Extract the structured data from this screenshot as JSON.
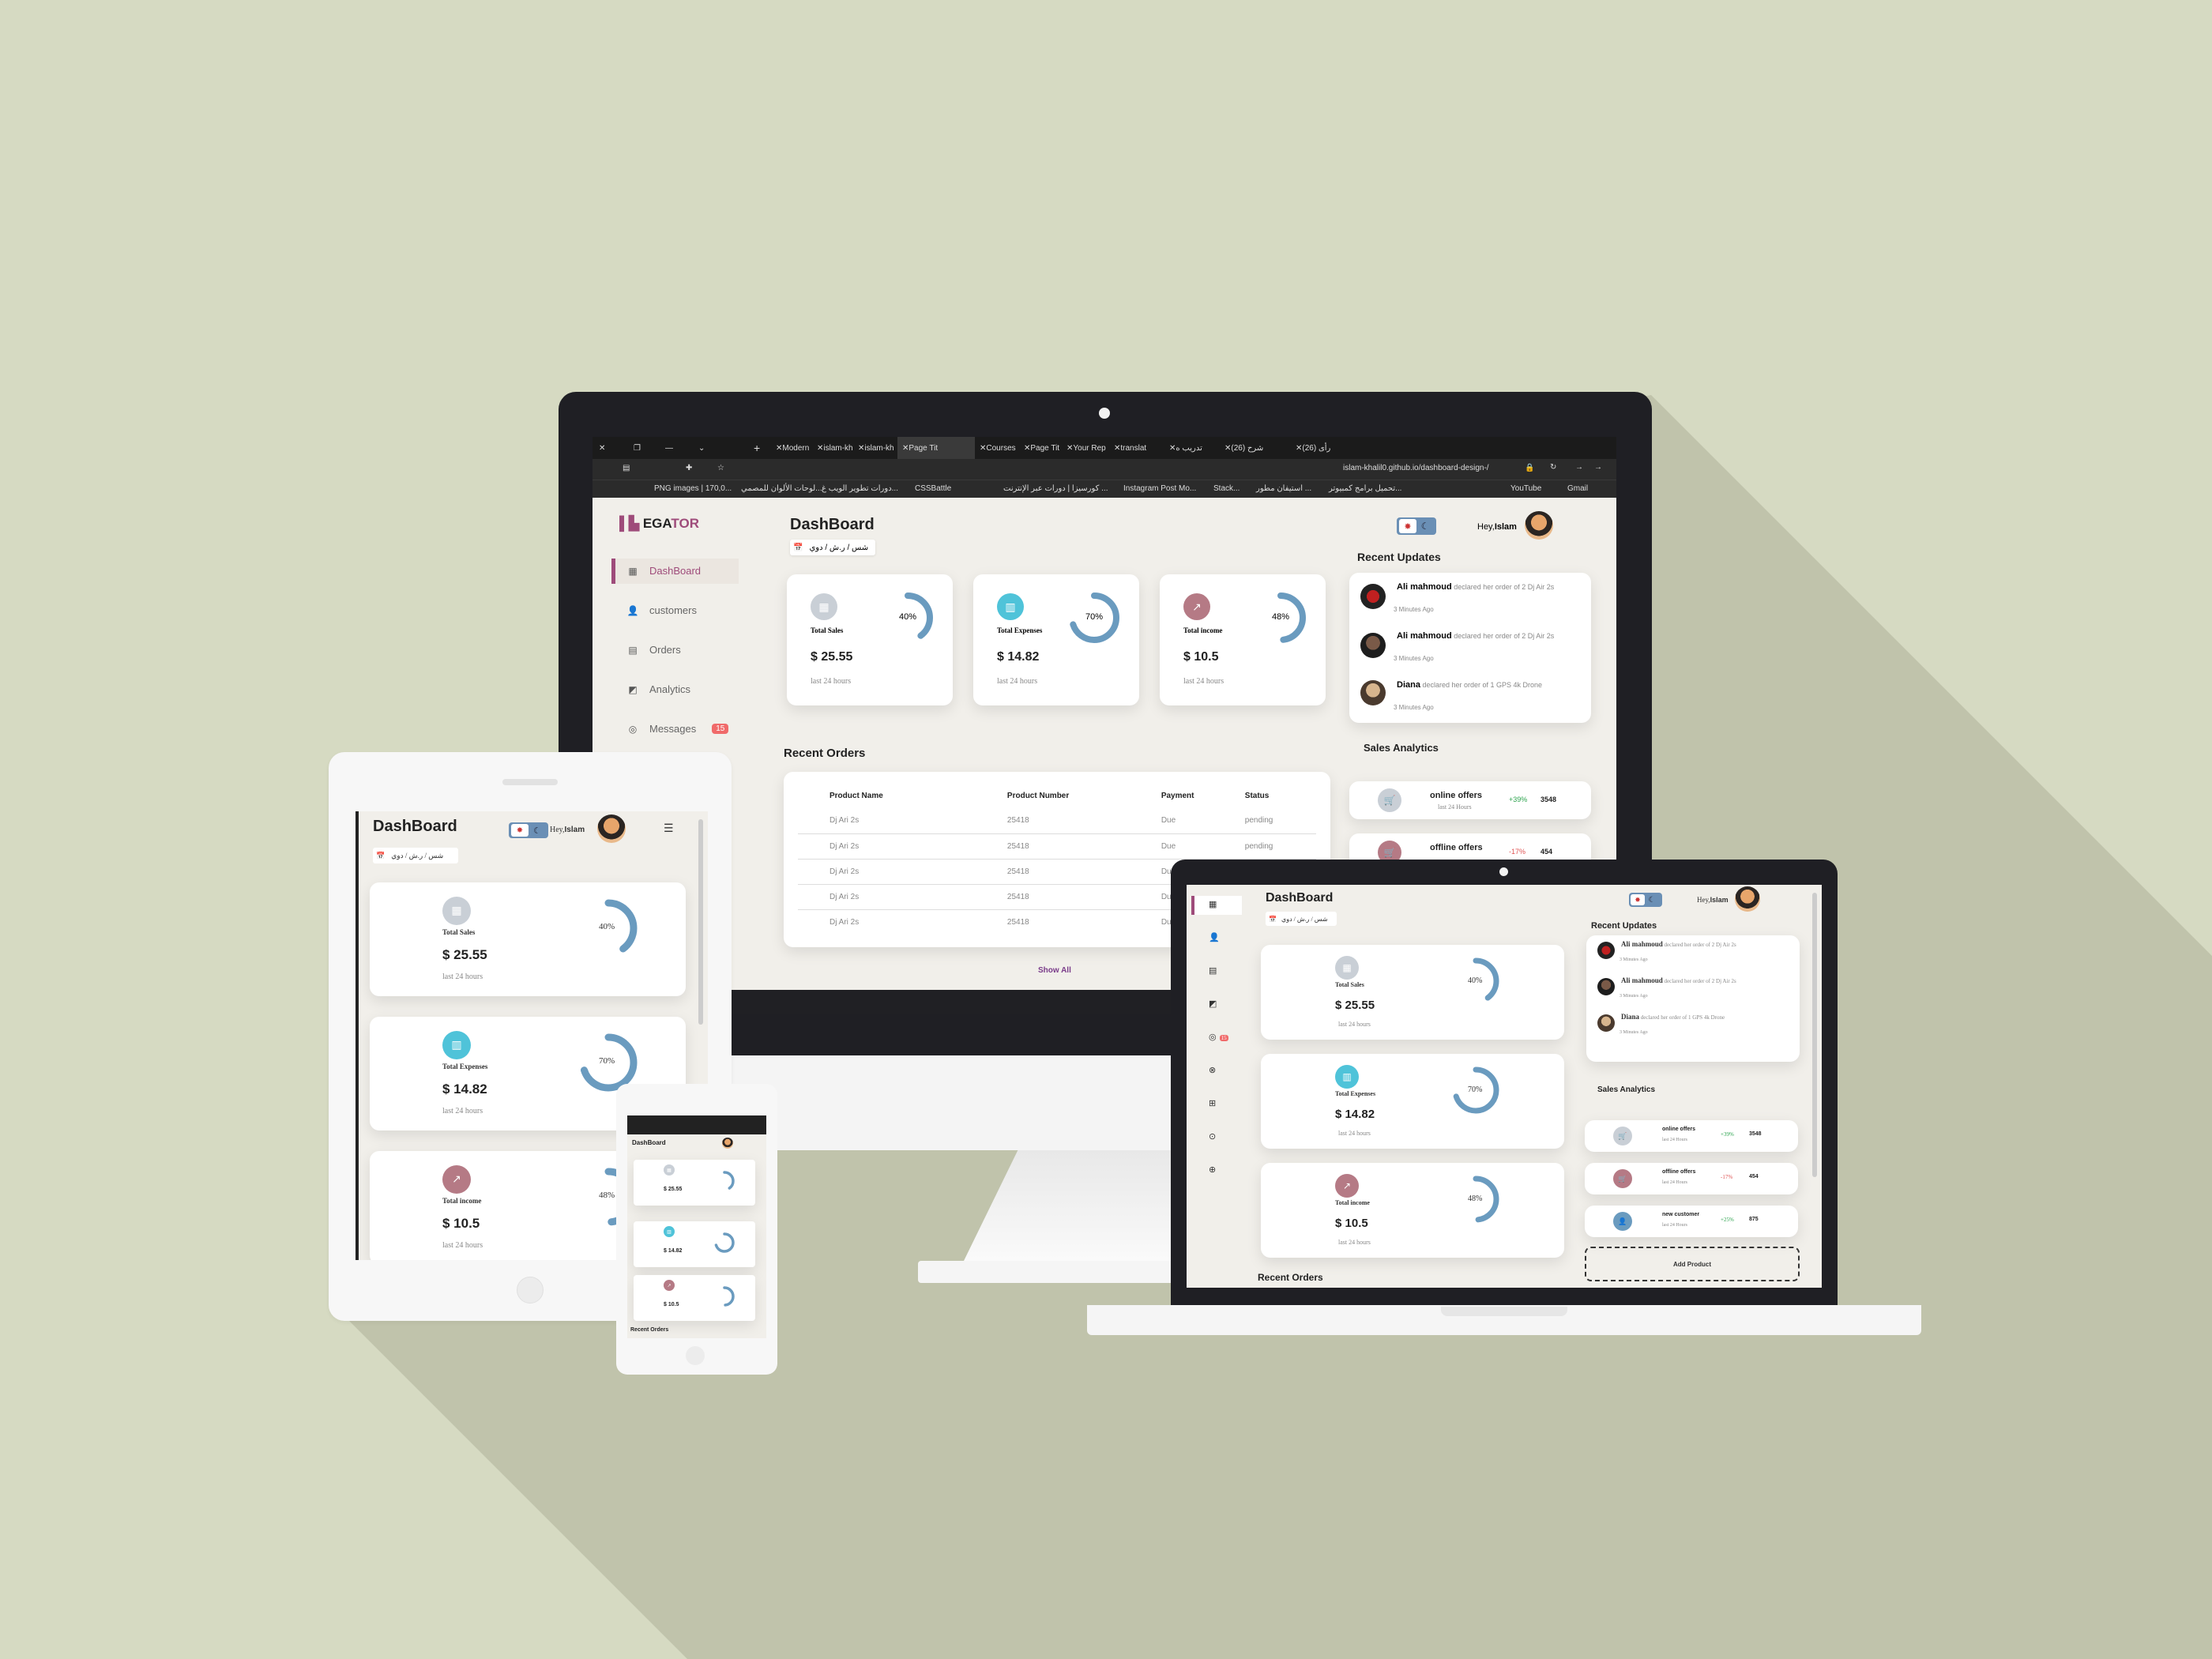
{
  "colors": {
    "background": "#d6dac2",
    "accent": "#9e4b7a",
    "ring": "#6a9bbf",
    "sales_icon": "#c9cfd6",
    "expenses_icon": "#4fc3d9",
    "income_icon": "#b57a85",
    "positive": "#2ea44f",
    "negative": "#e05555"
  },
  "browser": {
    "tabs": [
      "Modern",
      "islam-kh",
      "islam-kh",
      "Page Tit",
      "Courses",
      "Page Tit",
      "Your Rep",
      "translat",
      "تدريب ه",
      "(26) شرح",
      "(26) رأى"
    ],
    "url": "islam-khalil0.github.io/dashboard-design-/",
    "bookmarks": [
      "PNG images | 170,0...",
      "لوحات الألوان للمصمي...",
      "دورات تطوير الويب غ...",
      "CSSBattle",
      "كورسيزا | دورات عبر الإنترنت ...",
      "Instagram Post Mo...",
      "Stack...",
      "استيفان مطور ...",
      "تحميل برامج كمبيوتر...",
      "YouTube",
      "Gmail"
    ]
  },
  "brand": {
    "prefix": "EGA",
    "suffix": "TOR"
  },
  "nav": [
    {
      "label": "DashBoard",
      "icon": "grid-icon"
    },
    {
      "label": "customers",
      "icon": "user-icon"
    },
    {
      "label": "Orders",
      "icon": "clipboard-icon"
    },
    {
      "label": "Analytics",
      "icon": "chart-icon"
    },
    {
      "label": "Messages",
      "icon": "message-icon",
      "badge": "15"
    }
  ],
  "header": {
    "title": "DashBoard",
    "date": "شس / ر.ش / دوي",
    "greeting": "Hey,",
    "user": "Islam"
  },
  "stats": [
    {
      "label": "Total Sales",
      "value": "$ 25.55",
      "sub": "last 24 hours",
      "percent": "40%",
      "fraction": 0.4,
      "icon": "sales-icon"
    },
    {
      "label": "Total Expenses",
      "value": "$ 14.82",
      "sub": "last 24 hours",
      "percent": "70%",
      "fraction": 0.7,
      "icon": "expenses-icon"
    },
    {
      "label": "Total income",
      "value": "$ 10.5",
      "sub": "last 24 hours",
      "percent": "48%",
      "fraction": 0.48,
      "icon": "income-icon"
    }
  ],
  "recent_updates": {
    "title": "Recent Updates",
    "items": [
      {
        "name": "Ali mahmoud",
        "text": "declared her order of 2 Dj Air 2s",
        "time": "3 Minutes Ago"
      },
      {
        "name": "Ali mahmoud",
        "text": "declared her order of 2 Dj Air 2s",
        "time": "3 Minutes Ago"
      },
      {
        "name": "Diana",
        "text": "declared her order of 1 GPS 4k Drone",
        "time": "3 Minutes Ago"
      }
    ]
  },
  "sales_analytics": {
    "title": "Sales Analytics",
    "items": [
      {
        "label": "online offers",
        "sub": "last 24 Hours",
        "change": "+39%",
        "value": "3548"
      },
      {
        "label": "offline offers",
        "sub": "last 24 Hours",
        "change": "-17%",
        "value": "454"
      },
      {
        "label": "new customer",
        "sub": "last 24 Hours",
        "change": "+25%",
        "value": "875"
      }
    ],
    "add_label": "Add Product"
  },
  "recent_orders": {
    "title": "Recent Orders",
    "headers": [
      "Product Name",
      "Product Number",
      "Payment",
      "Status"
    ],
    "rows": [
      [
        "Dj Ari 2s",
        "25418",
        "Due",
        "pending"
      ],
      [
        "Dj Ari 2s",
        "25418",
        "Due",
        "pending"
      ],
      [
        "Dj Ari 2s",
        "25418",
        "Due",
        ""
      ],
      [
        "Dj Ari 2s",
        "25418",
        "Due",
        ""
      ],
      [
        "Dj Ari 2s",
        "25418",
        "Due",
        ""
      ]
    ],
    "show_all": "Show All"
  }
}
